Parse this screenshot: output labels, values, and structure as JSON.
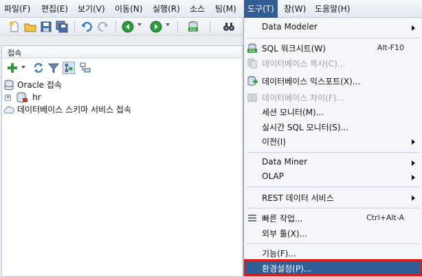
{
  "menubar": {
    "items": [
      "파일(F)",
      "편집(E)",
      "보기(V)",
      "이동(N)",
      "실행(R)",
      "소스",
      "팀(M)",
      "도구(T)",
      "창(W)",
      "도움말(H)"
    ],
    "active_index": 7
  },
  "toolbar": {
    "icons": [
      "new-icon",
      "open-icon",
      "save-icon",
      "save-all-icon",
      "undo-icon",
      "redo-icon",
      "back-icon",
      "forward-icon",
      "sql-icon",
      "binoculars-icon"
    ]
  },
  "connections": {
    "tab_label": "접속",
    "toolbar_icons": [
      "add-connection-icon",
      "refresh-icon",
      "filter-icon",
      "schema-browser-icon",
      "tree-icon"
    ],
    "tree": {
      "root_label": "Oracle 접속",
      "child_label": "hr",
      "schema_service_label": "데이터베이스 스키마 서비스 접속"
    }
  },
  "tools_menu": {
    "items": [
      {
        "label": "Data Modeler",
        "submenu": true
      },
      {
        "label": "SQL 워크시트(W)",
        "shortcut": "Alt-F10",
        "icon": "sql-worksheet-icon"
      },
      {
        "label": "데이터베이스 복사(C)...",
        "disabled": true,
        "icon": "copy-db-icon"
      },
      {
        "label": "데이터베이스 익스포트(X)...",
        "icon": "export-db-icon"
      },
      {
        "label": "데이터베이스 차이(F)...",
        "disabled": true,
        "icon": "diff-db-icon"
      },
      {
        "label": "세션 모니터(M)..."
      },
      {
        "label": "실시간 SQL 모니터(S)..."
      },
      {
        "label": "이전(I)",
        "submenu": true
      },
      {
        "label": "Data Miner",
        "submenu": true
      },
      {
        "label": "OLAP",
        "submenu": true
      },
      {
        "label": "REST 데이터 서비스",
        "submenu": true
      },
      {
        "label": "빠른 작업...",
        "shortcut": "Ctrl+Alt-A",
        "icon": "quick-action-icon"
      },
      {
        "label": "외부 툴(X)..."
      },
      {
        "label": "기능(F)..."
      },
      {
        "label": "환경설정(P)...",
        "highlighted": true
      }
    ]
  },
  "colors": {
    "accent": "#2f5d94",
    "highlight_border": "#e01919",
    "disabled_text": "#9aa1aa"
  }
}
